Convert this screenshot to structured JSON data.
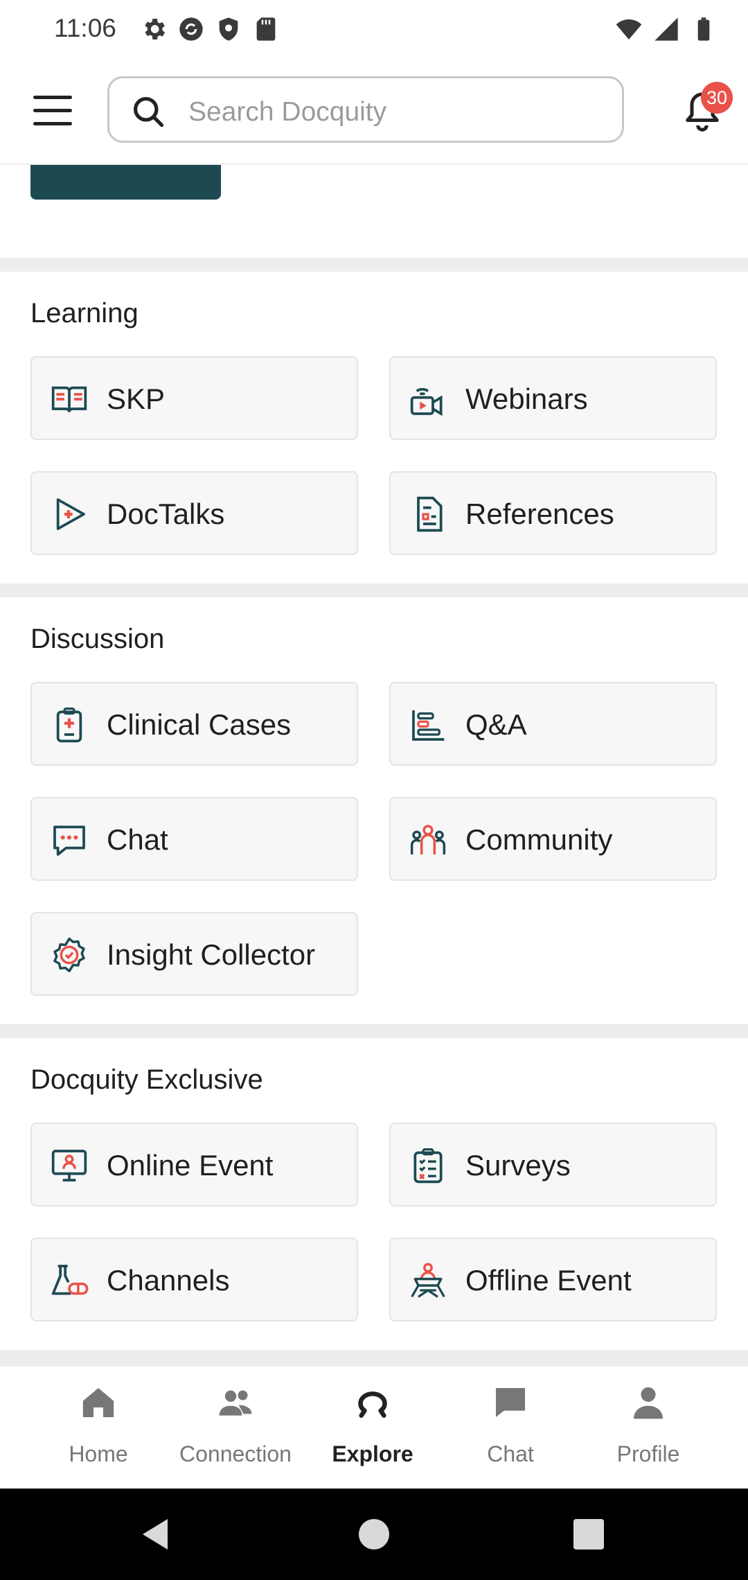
{
  "status": {
    "time": "11:06"
  },
  "search": {
    "placeholder": "Search Docquity"
  },
  "notifications": {
    "count": "30"
  },
  "sections": {
    "learning": {
      "title": "Learning",
      "items": [
        "SKP",
        "Webinars",
        "DocTalks",
        "References"
      ]
    },
    "discussion": {
      "title": "Discussion",
      "items": [
        "Clinical Cases",
        "Q&A",
        "Chat",
        "Community",
        "Insight Collector"
      ]
    },
    "exclusive": {
      "title": "Docquity Exclusive",
      "items": [
        "Online Event",
        "Surveys",
        "Channels",
        "Offline Event"
      ]
    }
  },
  "nav": {
    "items": [
      "Home",
      "Connection",
      "Explore",
      "Chat",
      "Profile"
    ],
    "active": "Explore"
  },
  "colors": {
    "teal": "#1d4a52",
    "accent_red": "#e8524a",
    "icon_dark": "#1d4a52"
  }
}
